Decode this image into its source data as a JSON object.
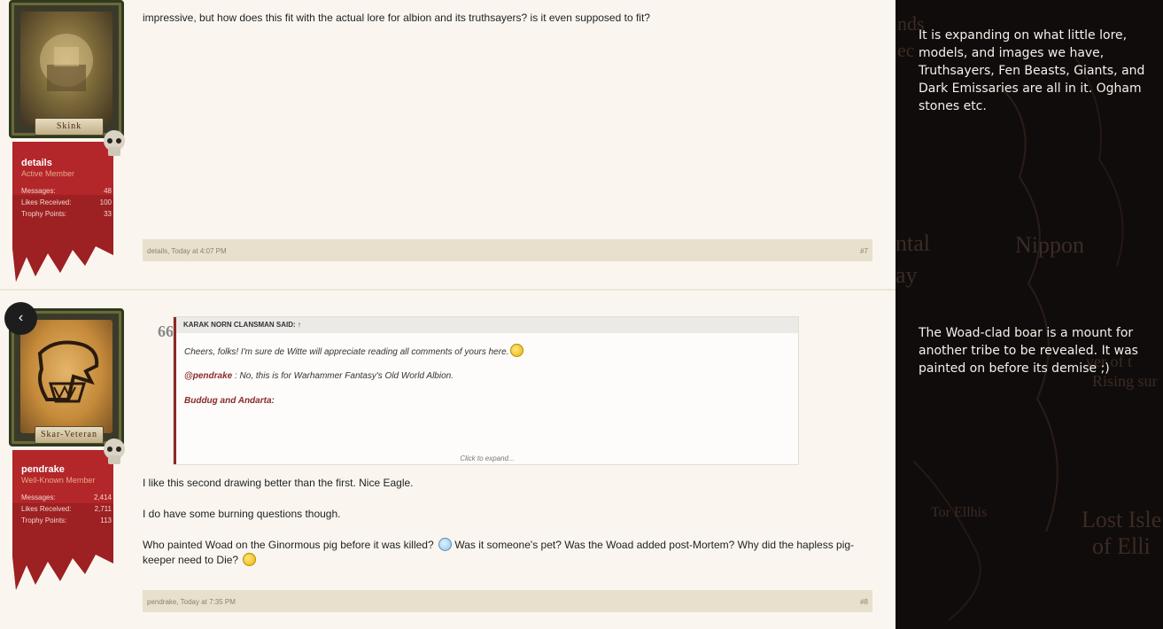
{
  "posts": [
    {
      "username": "details",
      "user_title": "Active Member",
      "rank_label": "Skink",
      "stats": [
        {
          "label": "Messages:",
          "value": "48"
        },
        {
          "label": "Likes Received:",
          "value": "100"
        },
        {
          "label": "Trophy Points:",
          "value": "33"
        }
      ],
      "body": "impressive, but how does this fit with the actual lore for albion and its truthsayers? is it even supposed to fit?",
      "meta": "details, Today at 4:07 PM",
      "permalink": "#7"
    },
    {
      "username": "pendrake",
      "user_title": "Well-Known Member",
      "rank_label": "Skar-Veteran",
      "stats": [
        {
          "label": "Messages:",
          "value": "2,414"
        },
        {
          "label": "Likes Received:",
          "value": "2,711"
        },
        {
          "label": "Trophy Points:",
          "value": "113"
        }
      ],
      "quote": {
        "header": "KARAK NORN CLANSMAN SAID: ↑",
        "line1": "Cheers, folks! I'm sure de Witte will appreciate reading all comments of yours here.",
        "mention": "@pendrake",
        "line2": " : No, this is for Warhammer Fantasy's Old World Albion.",
        "line3": "Buddug and Andarta:",
        "expand": "Click to expand..."
      },
      "p1": "I like this second drawing better than the first. Nice Eagle.",
      "p2": "I do have some burning questions though.",
      "p3a": "Who painted Woad on the Ginormous pig before it was killed?",
      "p3b": " Was it someone's pet? Was the Woad added post-Mortem? Why did the hapless pig-keeper need to Die?",
      "meta": "pendrake, Today at 7:35 PM",
      "permalink": "#8"
    }
  ],
  "nav": {
    "back_glyph": "‹"
  },
  "quote_glyph": "66",
  "panel": {
    "text1": "It is expanding on what little lore, models, and images we have, Truthsayers, Fen Beasts, Giants, and Dark Emissaries are all in it. Ogham stones etc.",
    "text2": "The Woad-clad boar is a mount for another tribe to be revealed. It was painted on before its demise ;)",
    "map_labels": [
      "Nippon",
      "Tor Ellhis",
      "Lost Isle",
      "of Elli",
      "ntal",
      "ay",
      "ver of t",
      "Rising sur",
      "nds",
      "ec"
    ]
  },
  "colors": {
    "accent": "#8a2a2a",
    "banner": "#b3262a",
    "footer": "#e8e0cd"
  }
}
